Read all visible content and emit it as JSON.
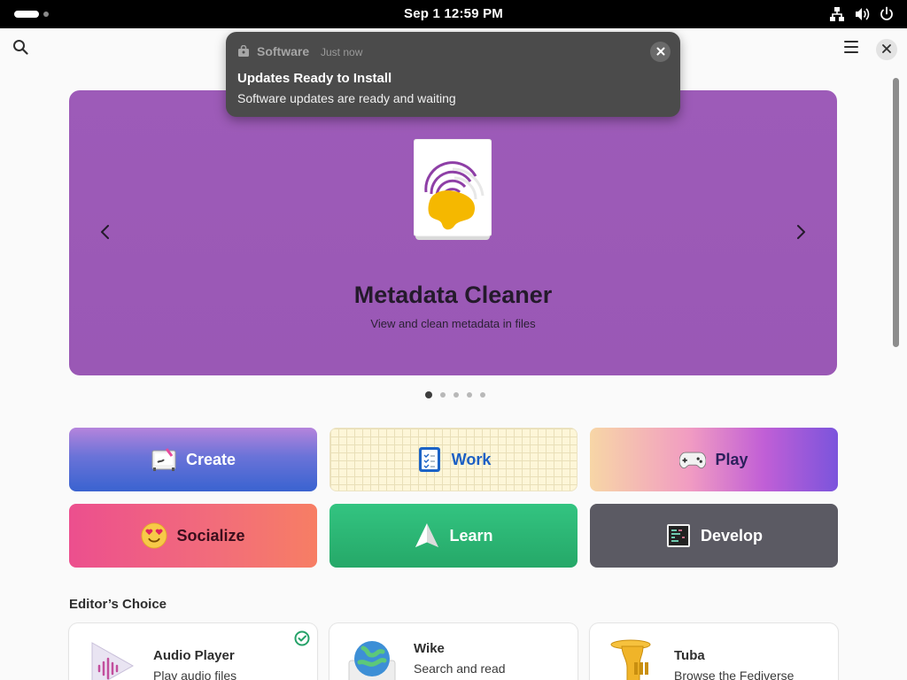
{
  "topbar": {
    "clock": "Sep 1  12:59 PM",
    "tray_icons": [
      "network-icon",
      "volume-icon",
      "power-icon"
    ]
  },
  "header": {
    "search_icon": "search-icon",
    "menu_icon": "hamburger-menu-icon",
    "close_icon": "close-icon"
  },
  "featured": {
    "title": "Metadata Cleaner",
    "subtitle": "View and clean metadata in files",
    "page_count": 5,
    "active_page": 1,
    "background": "#9b59b6"
  },
  "categories": [
    {
      "label": "Create",
      "icon": "paint-palette-icon"
    },
    {
      "label": "Work",
      "icon": "checklist-icon"
    },
    {
      "label": "Play",
      "icon": "gamepad-icon"
    },
    {
      "label": "Socialize",
      "icon": "heart-eyes-emoji-icon"
    },
    {
      "label": "Learn",
      "icon": "paper-plane-icon"
    },
    {
      "label": "Develop",
      "icon": "terminal-icon"
    }
  ],
  "editors_choice": {
    "title": "Editor’s Choice",
    "apps": [
      {
        "name": "Audio Player",
        "description": "Play audio files",
        "installed": true
      },
      {
        "name": "Wike",
        "description": "Search and read",
        "installed": false
      },
      {
        "name": "Tuba",
        "description": "Browse the Fediverse",
        "installed": false
      }
    ]
  },
  "notification": {
    "app": "Software",
    "time": "Just now",
    "title": "Updates Ready to Install",
    "body": "Software updates are ready and waiting"
  },
  "colors": {
    "banner": "#9b59b6",
    "accent_green": "#26a269",
    "topbar": "#000000"
  }
}
